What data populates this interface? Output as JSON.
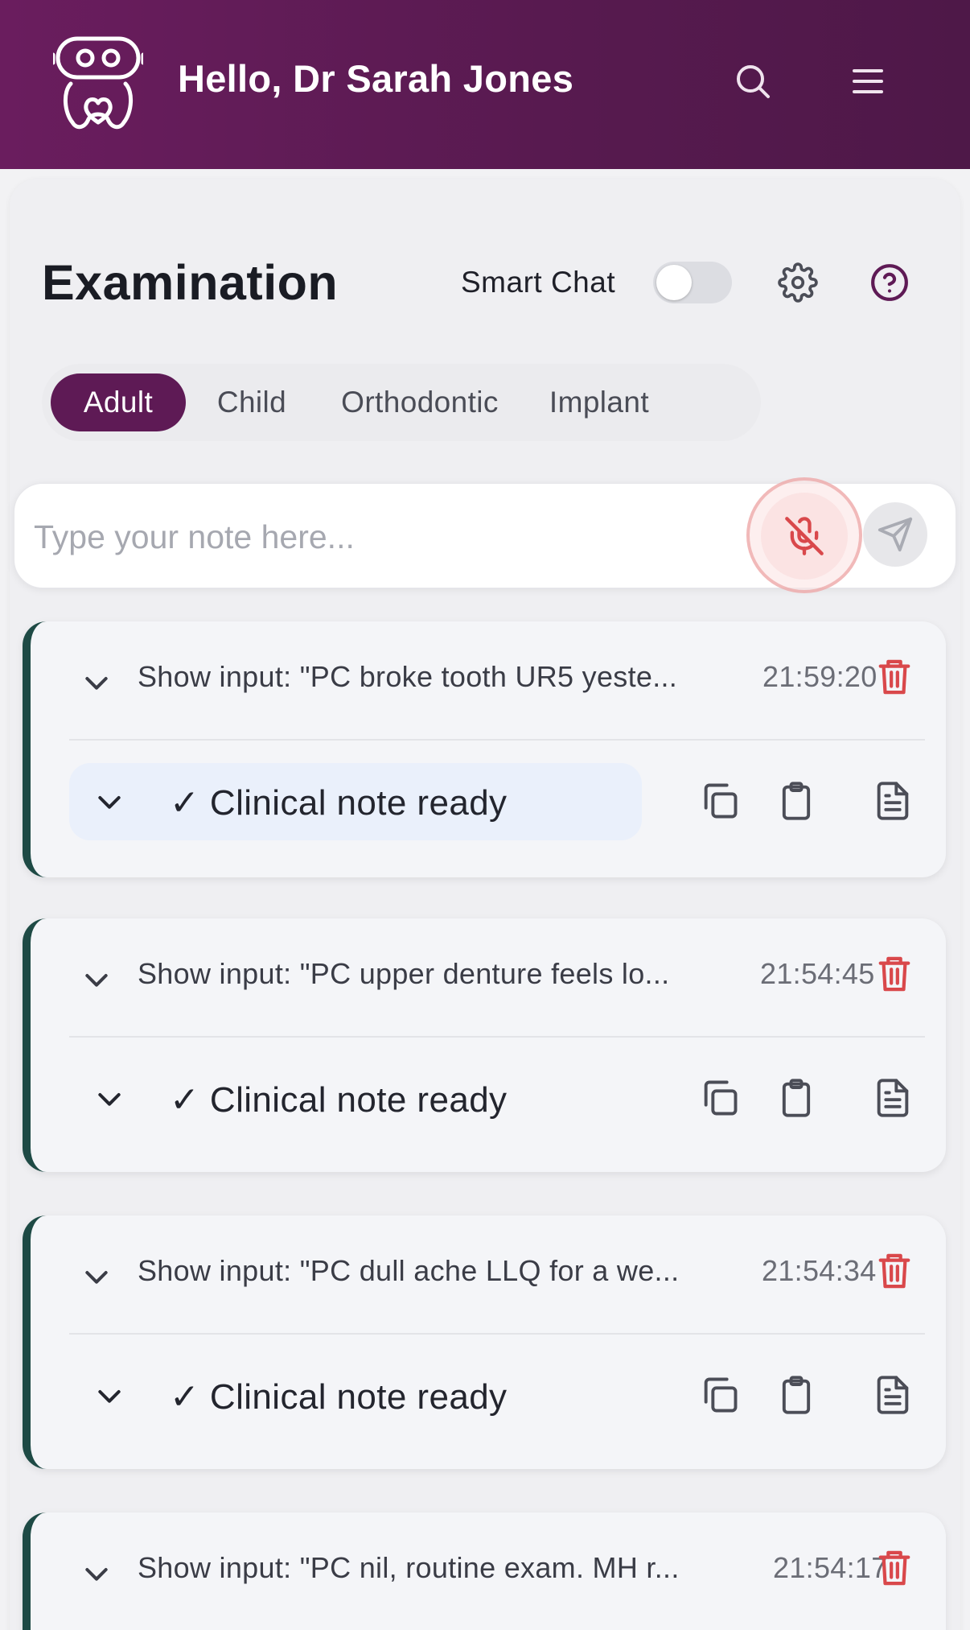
{
  "header": {
    "greeting": "Hello, Dr Sarah Jones",
    "icons": [
      "robot-tooth-logo",
      "search-icon",
      "hamburger-menu-icon"
    ]
  },
  "page": {
    "title": "Examination",
    "smart_chat_label": "Smart Chat",
    "smart_chat_enabled": false
  },
  "tabs": [
    {
      "label": "Adult",
      "active": true
    },
    {
      "label": "Child",
      "active": false
    },
    {
      "label": "Orthodontic",
      "active": false
    },
    {
      "label": "Implant",
      "active": false
    }
  ],
  "note_input": {
    "placeholder": "Type your note here...",
    "mic_state": "muted"
  },
  "notes": [
    {
      "input_preview": "Show input: \"PC broke tooth UR5 yeste...",
      "time": "21:59:20",
      "status": "✓ Clinical note ready"
    },
    {
      "input_preview": "Show input: \"PC upper denture feels lo...",
      "time": "21:54:45",
      "status": "✓ Clinical note ready"
    },
    {
      "input_preview": "Show input: \"PC dull ache LLQ for a we...",
      "time": "21:54:34",
      "status": "✓ Clinical note ready"
    },
    {
      "input_preview": "Show input: \"PC nil, routine exam. MH r...",
      "time": "21:54:17",
      "status": ""
    }
  ],
  "colors": {
    "header": "#5e1a55",
    "accent_border": "#1e4a45",
    "delete": "#d9484b",
    "mic": "#d9484b",
    "help": "#5e1a55"
  }
}
